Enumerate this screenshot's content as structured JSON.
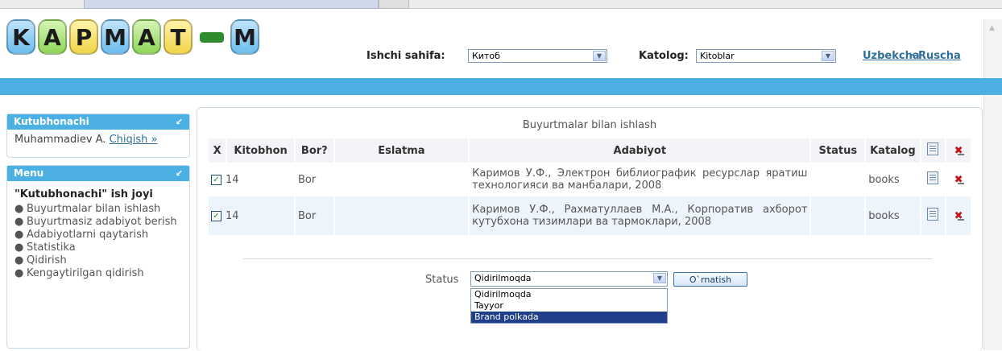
{
  "logo": {
    "letters": [
      {
        "char": "K",
        "color": "blue"
      },
      {
        "char": "A",
        "color": "green"
      },
      {
        "char": "P",
        "color": "yellow"
      },
      {
        "char": "M",
        "color": "blue"
      },
      {
        "char": "A",
        "color": "green"
      },
      {
        "char": "T",
        "color": "yellow"
      },
      {
        "char": "M",
        "color": "blue"
      }
    ]
  },
  "header": {
    "workpage_label": "Ishchi sahifa:",
    "workpage_value": "Китоб",
    "catalog_label": "Katolog:",
    "catalog_value": "Kitoblar",
    "lang_uz": "Uzbekcha",
    "lang_sep": "·",
    "lang_ru": "Ruscha"
  },
  "sidebar": {
    "user_panel_title": "Kutubhonachi",
    "user_name": "Muhammadiev A.",
    "logout_link": "Chiqish »",
    "menu_title": "Menu",
    "menu_heading": "\"Kutubhonachi\" ish joyi",
    "items": [
      {
        "label": "Buyurtmalar bilan ishlash"
      },
      {
        "label": "Buyurtmasiz adabiyot berish"
      },
      {
        "label": "Adabiyotlarni qaytarish"
      },
      {
        "label": "Statistika"
      },
      {
        "label": "Qidirish"
      },
      {
        "label": "Kengaytirilgan qidirish"
      }
    ]
  },
  "main": {
    "title": "Buyurtmalar bilan ishlash",
    "columns": {
      "x": "X",
      "reader": "Kitobhon",
      "available": "Bor?",
      "note": "Eslatma",
      "literature": "Adabiyot",
      "status": "Status",
      "catalog": "Katalog"
    },
    "rows": [
      {
        "checked": true,
        "reader": "14",
        "available": "Bor",
        "note": "",
        "literature": "Каримов У.Ф., Электрон библиографик ресурслар яратиш технологияси ва манбалари, 2008",
        "status": "",
        "catalog": "books"
      },
      {
        "checked": true,
        "reader": "14",
        "available": "Bor",
        "note": "",
        "literature": "Каримов У.Ф., Рахматуллаев М.А., Корпоратив ахборот кутубхона тизимлари ва тармоклари, 2008",
        "status": "",
        "catalog": "books"
      }
    ],
    "status_label": "Status",
    "status_value": "Qidirilmoqda",
    "status_options": [
      "Qidirilmoqda",
      "Tayyor",
      "Brand polkada"
    ],
    "status_highlighted": "Brand polkada",
    "submit_label": "O`rnatish"
  },
  "colors": {
    "accent": "#4cb0e4",
    "link": "#2f6f99",
    "delete": "#c0141a"
  }
}
